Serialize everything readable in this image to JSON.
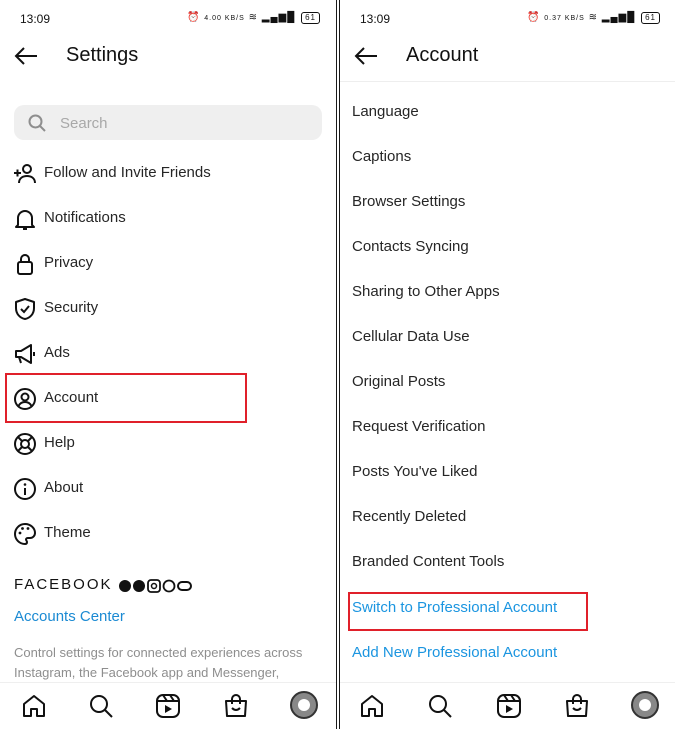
{
  "left": {
    "status": {
      "time": "13:09",
      "speed": "4.00 KB/S",
      "battery": "61"
    },
    "header": {
      "title": "Settings"
    },
    "search": {
      "placeholder": "Search"
    },
    "items": [
      {
        "label": "Follow and Invite Friends",
        "icon": "add-person-icon"
      },
      {
        "label": "Notifications",
        "icon": "bell-icon"
      },
      {
        "label": "Privacy",
        "icon": "lock-icon"
      },
      {
        "label": "Security",
        "icon": "shield-icon"
      },
      {
        "label": "Ads",
        "icon": "megaphone-icon"
      },
      {
        "label": "Account",
        "icon": "user-circle-icon"
      },
      {
        "label": "Help",
        "icon": "lifebuoy-icon"
      },
      {
        "label": "About",
        "icon": "info-icon"
      },
      {
        "label": "Theme",
        "icon": "palette-icon"
      }
    ],
    "facebook": {
      "label": "FACEBOOK",
      "icons": [
        "facebook-icon",
        "messenger-icon",
        "instagram-icon",
        "whatsapp-icon",
        "portal-icon"
      ]
    },
    "accounts_center": "Accounts Center",
    "description": "Control settings for connected experiences across Instagram, the Facebook app and Messenger,"
  },
  "right": {
    "status": {
      "time": "13:09",
      "speed": "0.37 KB/S",
      "battery": "61"
    },
    "header": {
      "title": "Account"
    },
    "items": [
      {
        "label": "Language"
      },
      {
        "label": "Captions"
      },
      {
        "label": "Browser Settings"
      },
      {
        "label": "Contacts Syncing"
      },
      {
        "label": "Sharing to Other Apps"
      },
      {
        "label": "Cellular Data Use"
      },
      {
        "label": "Original Posts"
      },
      {
        "label": "Request Verification"
      },
      {
        "label": "Posts You've Liked"
      },
      {
        "label": "Recently Deleted"
      },
      {
        "label": "Branded Content Tools"
      }
    ],
    "switch_professional": "Switch to Professional Account",
    "add_professional": "Add New Professional Account"
  },
  "nav": [
    "home-icon",
    "search-icon",
    "reels-icon",
    "shop-icon",
    "profile-avatar"
  ],
  "colors": {
    "link": "#1b95e0",
    "highlight": "#e0202a"
  }
}
